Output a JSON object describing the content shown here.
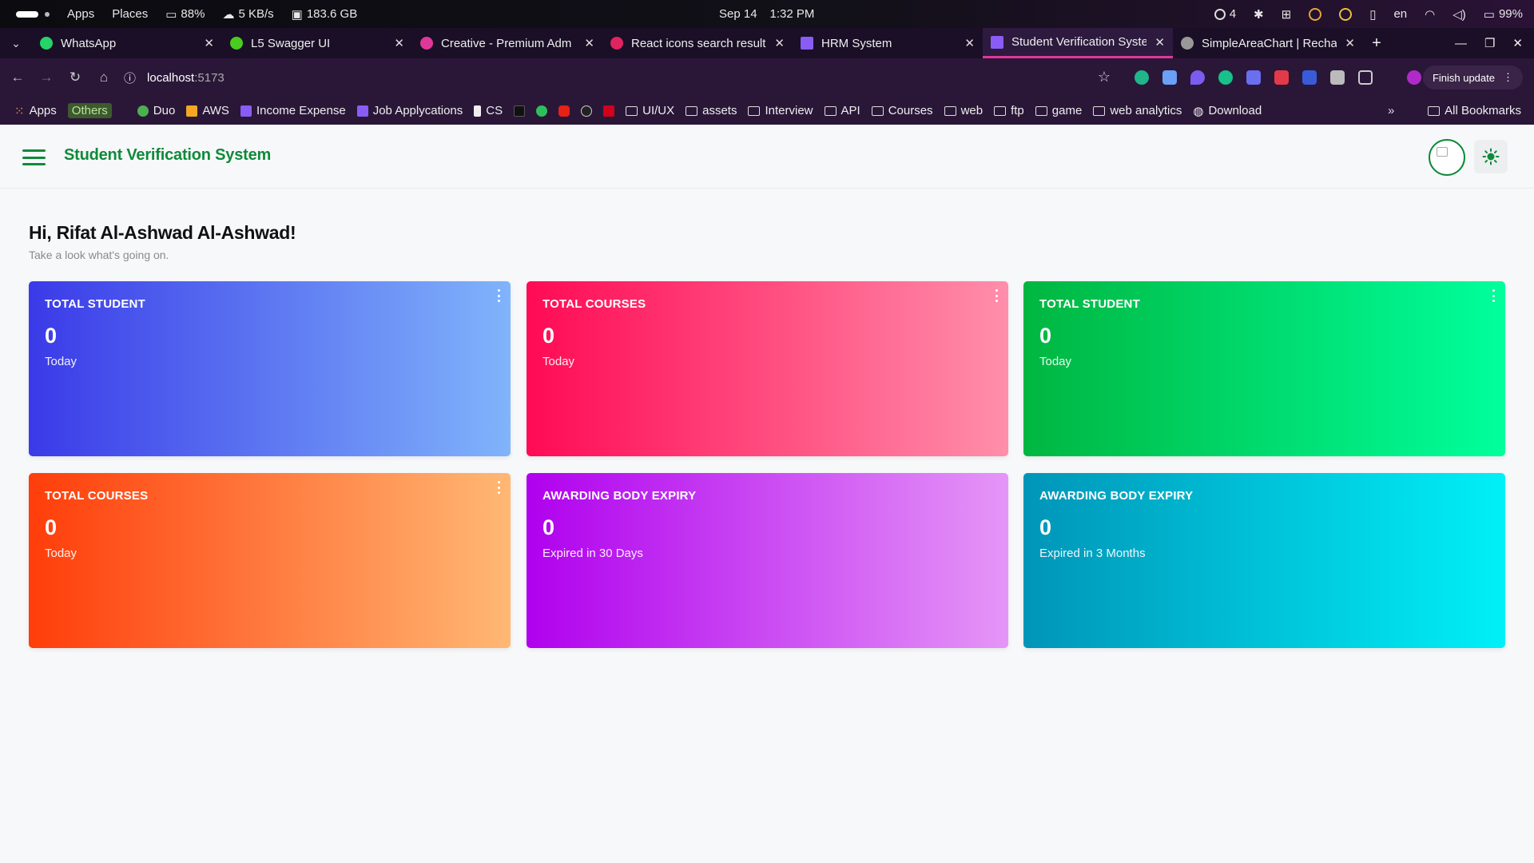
{
  "os": {
    "apps": "Apps",
    "places": "Places",
    "battery": "88%",
    "net": "5 KB/s",
    "disk": "183.6 GB",
    "date": "Sep 14",
    "time": "1:32 PM",
    "notif_count": "4",
    "lang": "en",
    "battery_right": "99%"
  },
  "tabs": [
    {
      "label": "WhatsApp",
      "color": "#25d366"
    },
    {
      "label": "L5 Swagger UI",
      "color": "#49cc1e"
    },
    {
      "label": "Creative - Premium Adm",
      "color": "#e0389a"
    },
    {
      "label": "React icons search result",
      "color": "#e0245e"
    },
    {
      "label": "HRM System",
      "color": "#8a5cf6"
    },
    {
      "label": "Student Verification Syste",
      "color": "#8a5cf6"
    },
    {
      "label": "SimpleAreaChart | Recha",
      "color": "#999999"
    }
  ],
  "address": {
    "host": "localhost",
    "port": ":5173",
    "finish_update": "Finish update"
  },
  "bookmarks": {
    "apps": "Apps",
    "others": "Others",
    "items": [
      "Duo",
      "AWS",
      "Income Expense",
      "Job Applycations",
      "CS"
    ],
    "folders": [
      "UI/UX",
      "assets",
      "Interview",
      "API",
      "Courses",
      "web",
      "ftp",
      "game",
      "web analytics"
    ],
    "download": "Download",
    "more": "»",
    "all": "All Bookmarks"
  },
  "app": {
    "title": "Student Verification System"
  },
  "greeting": {
    "title": "Hi, Rifat Al-Ashwad Al-Ashwad!",
    "subtitle": "Take a look what's going on."
  },
  "cards": [
    {
      "title": "TOTAL STUDENT",
      "value": "0",
      "sub": "Today",
      "from": "#3a3ae8",
      "to": "#80b4fb"
    },
    {
      "title": "TOTAL COURSES",
      "value": "0",
      "sub": "Today",
      "from": "#ff0a54",
      "to": "#ff8fab"
    },
    {
      "title": "TOTAL STUDENT",
      "value": "0",
      "sub": "Today",
      "from": "#00b640",
      "to": "#00ff9c"
    },
    {
      "title": "TOTAL COURSES",
      "value": "0",
      "sub": "Today",
      "from": "#ff3d0a",
      "to": "#ffb874"
    },
    {
      "title": "AWARDING BODY EXPIRY",
      "value": "0",
      "sub": "Expired in 30 Days",
      "from": "#b000ee",
      "to": "#e596f7"
    },
    {
      "title": "AWARDING BODY EXPIRY",
      "value": "0",
      "sub": "Expired in 3 Months",
      "from": "#0095b8",
      "to": "#00f0f8"
    }
  ],
  "colors": {
    "accent": "#0f8a3a",
    "background": "#f7f8fa"
  }
}
